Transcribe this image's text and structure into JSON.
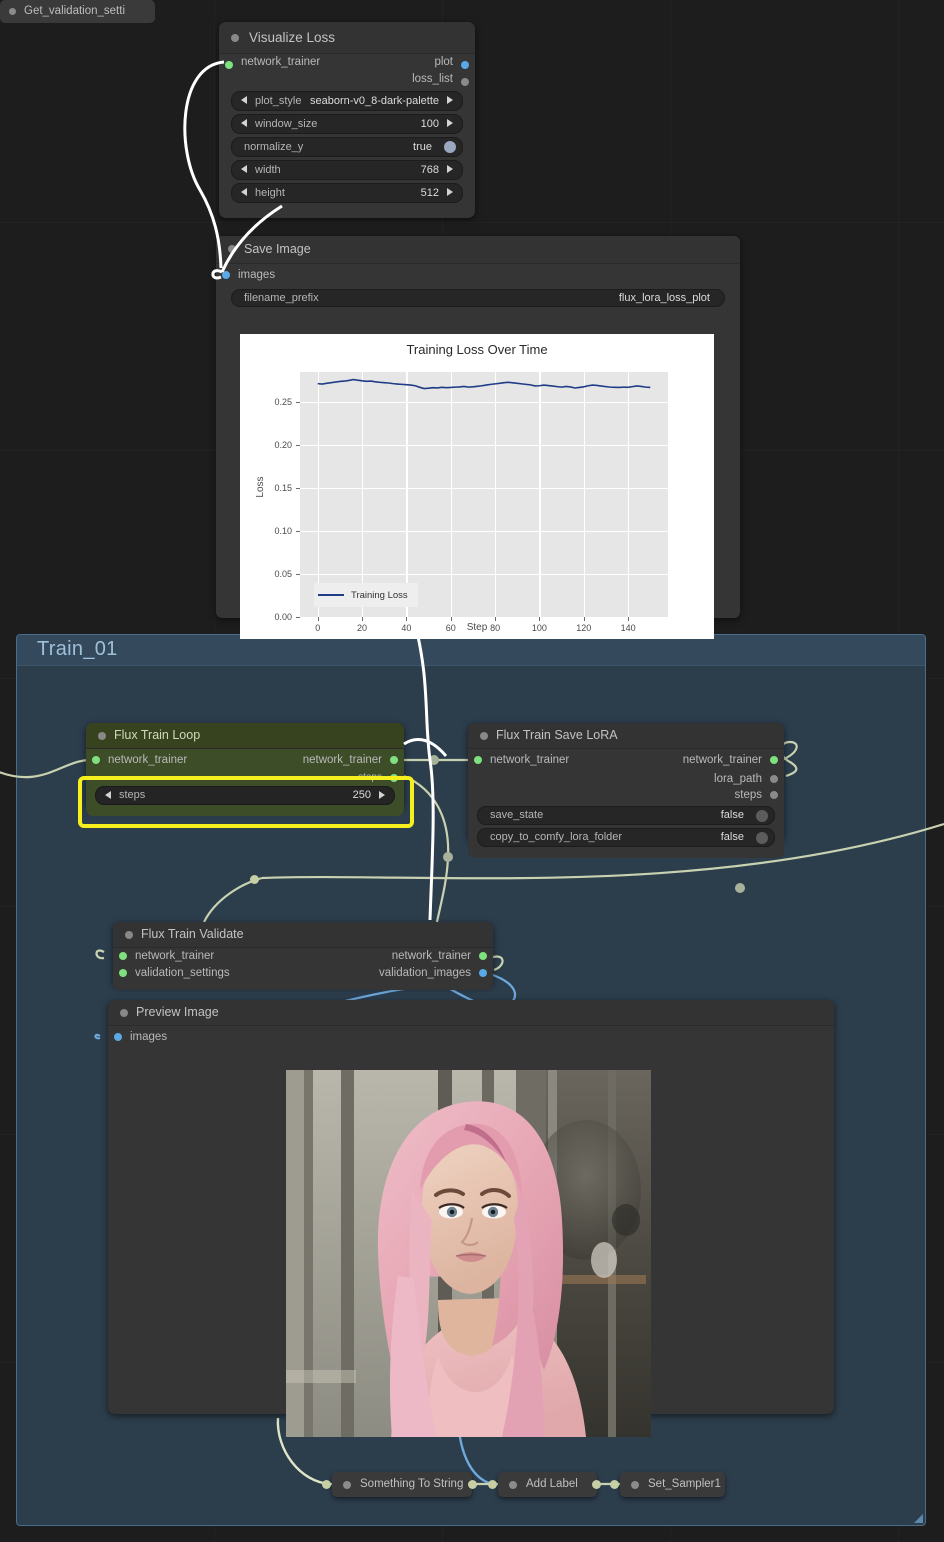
{
  "canvas": {
    "background": "#1d1d1d",
    "group": {
      "title": "Train_01",
      "background": "#2c3d4c",
      "border": "#4a6d8c"
    }
  },
  "nodes": {
    "visualize_loss": {
      "title": "Visualize Loss",
      "inputs": [
        {
          "name": "network_trainer",
          "type": "green"
        }
      ],
      "outputs": [
        {
          "name": "plot",
          "type": "blue"
        },
        {
          "name": "loss_list",
          "type": "grey"
        }
      ],
      "widgets": [
        {
          "name": "plot_style",
          "value": "seaborn-v0_8-dark-palette",
          "kind": "combo"
        },
        {
          "name": "window_size",
          "value": "100",
          "kind": "number"
        },
        {
          "name": "normalize_y",
          "value": "true",
          "kind": "boolean"
        },
        {
          "name": "width",
          "value": "768",
          "kind": "number"
        },
        {
          "name": "height",
          "value": "512",
          "kind": "number"
        }
      ]
    },
    "save_image": {
      "title": "Save Image",
      "inputs": [
        {
          "name": "images",
          "type": "blue"
        }
      ],
      "widgets": [
        {
          "name": "filename_prefix",
          "value": "flux_lora_loss_plot",
          "kind": "text"
        }
      ]
    },
    "flux_train_loop": {
      "title": "Flux Train Loop",
      "inputs": [
        {
          "name": "network_trainer",
          "type": "green"
        }
      ],
      "outputs": [
        {
          "name": "network_trainer",
          "type": "green"
        },
        {
          "name": "steps",
          "type": "green"
        }
      ],
      "widgets": [
        {
          "name": "steps",
          "value": "250",
          "kind": "number"
        }
      ],
      "highlighted_widget": "steps",
      "highlight_color": "#f5ef1e"
    },
    "flux_train_save_lora": {
      "title": "Flux Train Save LoRA",
      "inputs": [
        {
          "name": "network_trainer",
          "type": "green"
        }
      ],
      "outputs": [
        {
          "name": "network_trainer",
          "type": "green"
        },
        {
          "name": "lora_path",
          "type": "grey"
        },
        {
          "name": "steps",
          "type": "grey"
        }
      ],
      "widgets": [
        {
          "name": "save_state",
          "value": "false",
          "kind": "boolean"
        },
        {
          "name": "copy_to_comfy_lora_folder",
          "value": "false",
          "kind": "boolean"
        }
      ]
    },
    "get_validation_settings": {
      "title": "Get_validation_setti",
      "collapsed": true
    },
    "flux_train_validate": {
      "title": "Flux Train Validate",
      "inputs": [
        {
          "name": "network_trainer",
          "type": "green"
        },
        {
          "name": "validation_settings",
          "type": "green"
        }
      ],
      "outputs": [
        {
          "name": "network_trainer",
          "type": "green"
        },
        {
          "name": "validation_images",
          "type": "blue"
        }
      ]
    },
    "preview_image": {
      "title": "Preview Image",
      "inputs": [
        {
          "name": "images",
          "type": "blue"
        }
      ]
    },
    "something_to_string": {
      "title": "Something To String",
      "collapsed": true
    },
    "add_label": {
      "title": "Add Label",
      "collapsed": true
    },
    "set_sampler1": {
      "title": "Set_Sampler1",
      "collapsed": true
    }
  },
  "chart_data": {
    "type": "line",
    "title": "Training Loss Over Time",
    "xlabel": "Step",
    "ylabel": "Loss",
    "xlim": [
      -8,
      158
    ],
    "ylim": [
      0.0,
      0.285
    ],
    "grid": true,
    "legend_position": "lower left",
    "yticks": [
      "0.00",
      "0.05",
      "0.10",
      "0.15",
      "0.20",
      "0.25"
    ],
    "ytick_values": [
      0.0,
      0.05,
      0.1,
      0.15,
      0.2,
      0.25
    ],
    "xticks": [
      "0",
      "20",
      "40",
      "60",
      "80",
      "100",
      "120",
      "140"
    ],
    "xtick_values": [
      0,
      20,
      40,
      60,
      80,
      100,
      120,
      140
    ],
    "series": [
      {
        "name": "Training Loss",
        "color": "#1f3d87",
        "x": [
          0,
          2,
          4,
          6,
          8,
          10,
          12,
          14,
          16,
          18,
          20,
          22,
          24,
          26,
          28,
          30,
          32,
          34,
          36,
          38,
          40,
          42,
          44,
          46,
          48,
          50,
          52,
          54,
          56,
          58,
          60,
          62,
          64,
          66,
          68,
          70,
          72,
          74,
          76,
          78,
          80,
          82,
          84,
          86,
          88,
          90,
          92,
          94,
          96,
          98,
          100,
          102,
          104,
          106,
          108,
          110,
          112,
          114,
          116,
          118,
          120,
          122,
          124,
          126,
          128,
          130,
          132,
          134,
          136,
          138,
          140,
          142,
          144,
          146,
          148,
          150
        ],
        "y": [
          0.2715,
          0.271,
          0.2718,
          0.2726,
          0.2733,
          0.274,
          0.2744,
          0.2752,
          0.2762,
          0.2755,
          0.2747,
          0.2742,
          0.2744,
          0.2736,
          0.273,
          0.2726,
          0.2722,
          0.2715,
          0.271,
          0.2706,
          0.2702,
          0.2698,
          0.269,
          0.2672,
          0.2658,
          0.2662,
          0.2668,
          0.2665,
          0.2672,
          0.2668,
          0.267,
          0.2674,
          0.2676,
          0.2682,
          0.2674,
          0.2678,
          0.2684,
          0.269,
          0.2698,
          0.2706,
          0.2712,
          0.2718,
          0.2726,
          0.273,
          0.2724,
          0.2718,
          0.2712,
          0.2706,
          0.27,
          0.2688,
          0.269,
          0.2698,
          0.2692,
          0.2686,
          0.268,
          0.2674,
          0.2682,
          0.2676,
          0.2664,
          0.267,
          0.2678,
          0.269,
          0.2698,
          0.2694,
          0.2686,
          0.268,
          0.2674,
          0.2672,
          0.267,
          0.2674,
          0.2672,
          0.268,
          0.2688,
          0.2682,
          0.2674,
          0.267
        ]
      }
    ]
  }
}
